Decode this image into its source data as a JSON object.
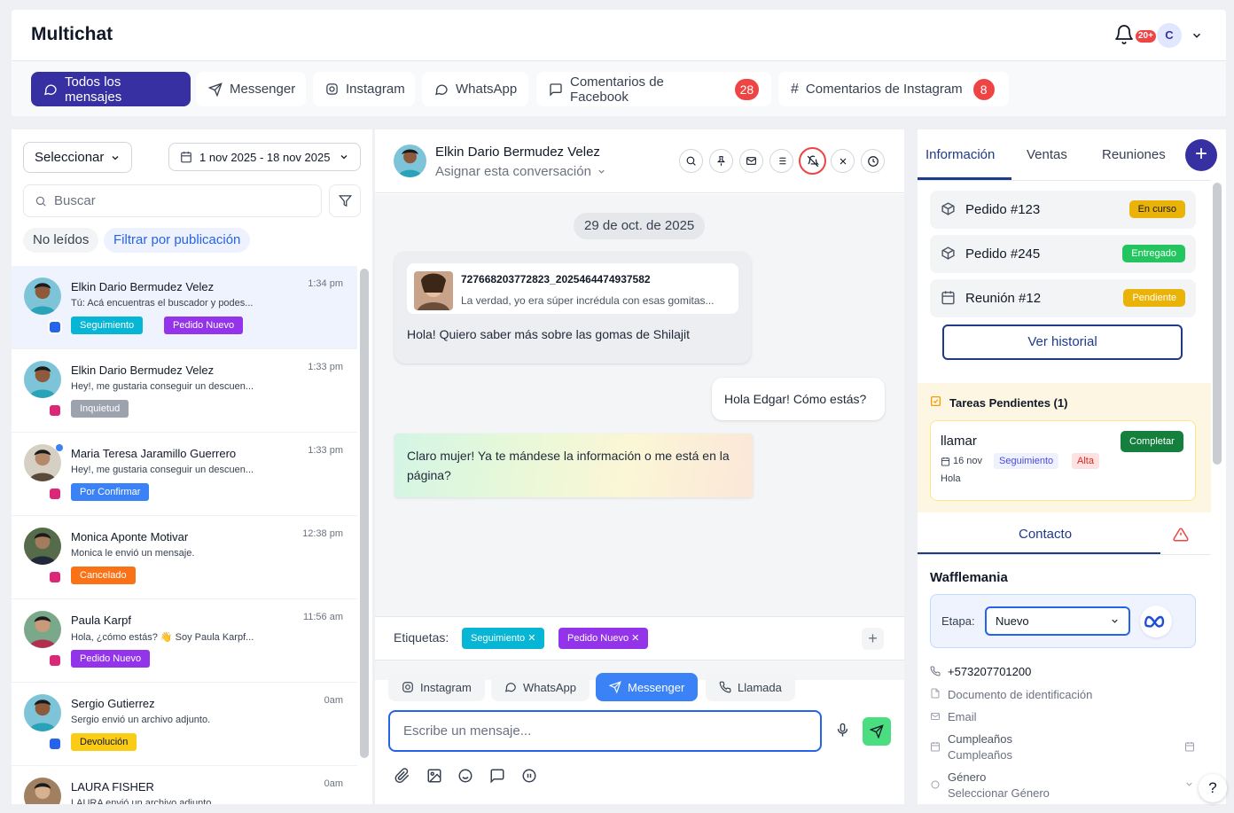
{
  "app": {
    "title": "Multichat",
    "notif_count": "20+",
    "user_initial": "C"
  },
  "tabs": [
    {
      "label": "Todos los mensajes",
      "icon": "chat-bubble-icon",
      "active": true
    },
    {
      "label": "Messenger",
      "icon": "send-icon"
    },
    {
      "label": "Instagram",
      "icon": "instagram-icon"
    },
    {
      "label": "WhatsApp",
      "icon": "whatsapp-icon"
    },
    {
      "label": "Comentarios de Facebook",
      "icon": "comment-icon",
      "count": "28"
    },
    {
      "label": "Comentarios de Instagram",
      "icon": "hash-icon",
      "count": "8"
    }
  ],
  "filters": {
    "select_label": "Seleccionar",
    "date_range": "1 nov 2025 - 18 nov 2025",
    "search_placeholder": "Buscar",
    "unread": "No leídos",
    "by_publication": "Filtrar por publicación"
  },
  "conversations": [
    {
      "name": "Elkin Dario Bermudez Velez",
      "time": "1:34 pm",
      "preview": "Tú: Acá encuentras el buscador y podes...",
      "channel": "messenger",
      "tags": [
        {
          "label": "Seguimiento",
          "color": "#06b6d4"
        },
        {
          "label": "Pedido Nuevo",
          "color": "#9333ea"
        }
      ]
    },
    {
      "name": "Elkin Dario Bermudez Velez",
      "time": "1:33 pm",
      "preview": "Hey!, me gustaria conseguir un descuen...",
      "channel": "instagram",
      "tags": [
        {
          "label": "Inquietud",
          "color": "#9ca3af"
        }
      ]
    },
    {
      "name": "Maria Teresa Jaramillo Guerrero",
      "time": "1:33 pm",
      "preview": "Hey!, me gustaria conseguir un descuen...",
      "channel": "instagram",
      "tags": [
        {
          "label": "Por Confirmar",
          "color": "#3b82f6"
        }
      ]
    },
    {
      "name": "Monica Aponte Motivar",
      "time": "12:38 pm",
      "preview": "Monica le envió un mensaje.",
      "channel": "instagram",
      "tags": [
        {
          "label": "Cancelado",
          "color": "#f97316"
        }
      ]
    },
    {
      "name": "Paula Karpf",
      "time": "11:56 am",
      "preview": "Hola, ¿cómo estás? 👋 Soy Paula Karpf...",
      "channel": "instagram",
      "tags": [
        {
          "label": "Pedido Nuevo",
          "color": "#9333ea"
        }
      ]
    },
    {
      "name": "Sergio Gutierrez",
      "time": "0am",
      "preview": "Sergio envió un archivo adjunto.",
      "channel": "messenger",
      "tags": [
        {
          "label": "Devolución",
          "color": "#facc15"
        }
      ]
    },
    {
      "name": "LAURA FISHER",
      "time": "0am",
      "preview": "LAURA envió un archivo adjunto.",
      "channel": "instagram",
      "tags": []
    }
  ],
  "chat": {
    "contact_name": "Elkin Dario Bermudez Velez",
    "assign_label": "Asignar esta conversación",
    "date_divider": "29 de oct. de 2025",
    "post_id": "727668203772823_2025464474937582",
    "post_text": "La verdad, yo era súper incrédula con esas gomitas...",
    "msg_in": "Hola! Quiero saber más sobre las gomas de Shilajit",
    "msg_out": "Hola Edgar! Cómo estás?",
    "msg_ai": "Claro mujer! Ya te mándese la información o me está en la página?",
    "etiquetas_label": "Etiquetas:",
    "etiquetas": [
      {
        "label": "Seguimiento",
        "color": "#06b6d4"
      },
      {
        "label": "Pedido Nuevo",
        "color": "#9333ea"
      }
    ],
    "channels": [
      "Instagram",
      "WhatsApp",
      "Messenger",
      "Llamada"
    ],
    "active_channel": "Messenger",
    "input_placeholder": "Escribe un mensaje..."
  },
  "info": {
    "tabs": [
      "Información",
      "Ventas",
      "Reuniones"
    ],
    "orders": [
      {
        "label": "Pedido #123",
        "status": "En curso",
        "color": "#eab308",
        "icon": "box-icon"
      },
      {
        "label": "Pedido #245",
        "status": "Entregado",
        "color": "#22c55e",
        "icon": "box-icon"
      },
      {
        "label": "Reunión #12",
        "status": "Pendiente",
        "color": "#eab308",
        "icon": "calendar-icon"
      }
    ],
    "history_button": "Ver historial",
    "tasks_title": "Tareas Pendientes (1)",
    "task": {
      "title": "llamar",
      "date": "16 nov",
      "tag": "Seguimiento",
      "priority": "Alta",
      "note": "Hola",
      "complete": "Completar"
    },
    "contact_tab": "Contacto",
    "company": "Wafflemania",
    "stage_label": "Etapa:",
    "stage_value": "Nuevo",
    "phone": "+573207701200",
    "doc": "Documento de identificación",
    "email": "Email",
    "birthday_label": "Cumpleaños",
    "birthday_value": "Cumpleaños",
    "gender_label": "Género",
    "gender_value": "Seleccionar Género",
    "help": "?"
  }
}
